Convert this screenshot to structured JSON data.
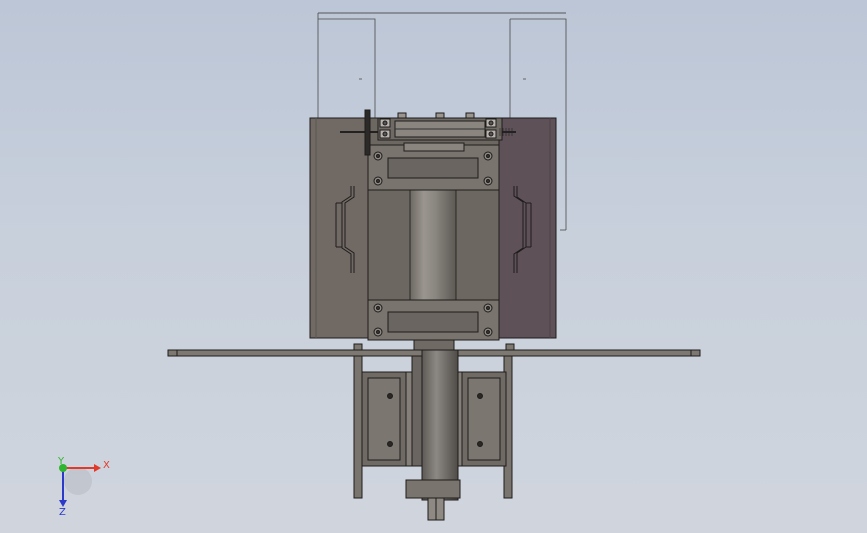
{
  "triad": {
    "x_label": "X",
    "y_label": "Y",
    "z_label": "Z",
    "x_color": "#e23a2a",
    "y_color": "#2fb52f",
    "z_color": "#2b3ac8"
  },
  "colors": {
    "background_top": "#bcc6d6",
    "background_bottom": "#d0d5dd",
    "body_gray": "#716a64",
    "body_shadow": "#5e5853",
    "body_purple": "#5f5158",
    "edge": "#1e1c1b",
    "column": "#8a8680",
    "ghost_line": "#4a4a4a"
  }
}
